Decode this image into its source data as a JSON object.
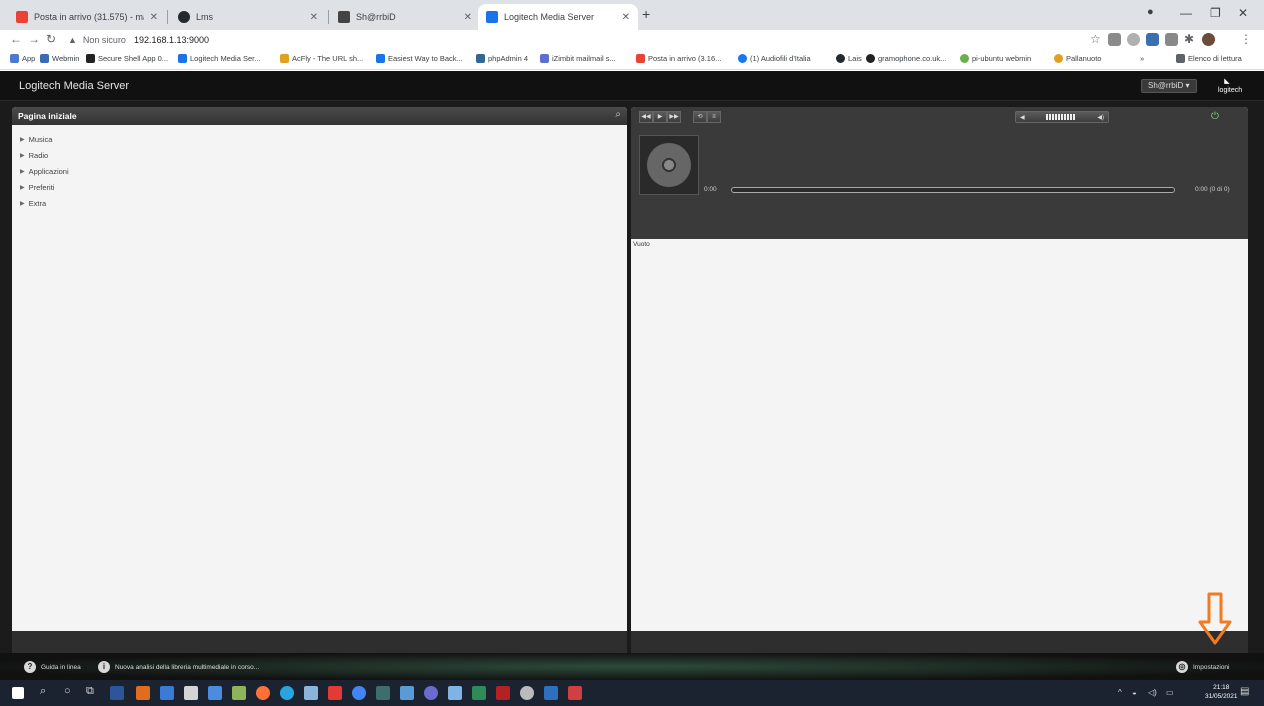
{
  "browser": {
    "tabs": [
      {
        "title": "Posta in arrivo (31.575) - marco.",
        "active": false
      },
      {
        "title": "Lms",
        "active": false
      },
      {
        "title": "Sh@rrbiD",
        "active": false
      },
      {
        "title": "Logitech Media Server",
        "active": true
      }
    ],
    "address": {
      "security": "Non sicuro",
      "url": "192.168.1.13:9000"
    },
    "bookmarks": [
      "App",
      "Webmin",
      "Secure Shell App 0...",
      "Logitech Media Ser...",
      "AcFly - The URL sh...",
      "Easiest Way to Back...",
      "phpAdmin 4",
      "iZimbit mailmail s...",
      "Posta in arrivo (3.16...",
      "(1) Audiofili d'Italia",
      "Lais",
      "gramophone.co.uk...",
      "pi-ubuntu webmin",
      "Pallanuoto"
    ],
    "reading_list": "Elenco di lettura"
  },
  "app": {
    "title": "Logitech Media Server",
    "player_name": "Sh@rrbiD",
    "logo_text": "logitech",
    "left_panel": {
      "title": "Pagina iniziale",
      "menu": [
        "Musica",
        "Radio",
        "Applicazioni",
        "Preferiti",
        "Extra"
      ]
    },
    "player": {
      "elapsed": "0:00",
      "remaining": "0:00 (0 di 0)",
      "status": "Vuoto"
    },
    "footer": {
      "help": "Guida in linea",
      "scan_status": "Nuova analisi della libreria multimediale in corso...",
      "settings": "Impostazioni"
    }
  },
  "taskbar": {
    "time": "21:18",
    "date": "31/05/2021"
  },
  "colors": {
    "app_bg": "#1b1b1b",
    "panel_bg": "#f4f4f4",
    "arrow": "#f47a20"
  }
}
